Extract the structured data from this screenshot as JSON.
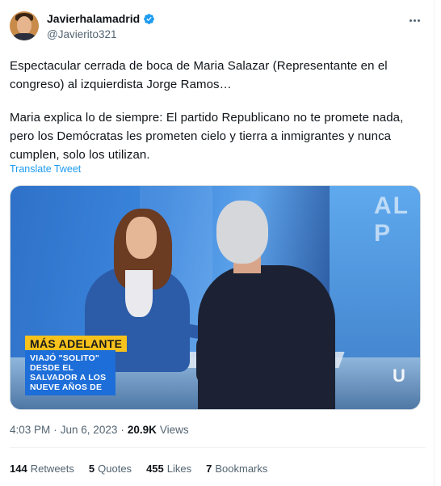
{
  "author": {
    "display_name": "Javierhalamadrid",
    "handle": "@Javierito321",
    "verified_badge_color": "#1d9bf0"
  },
  "tweet": {
    "paragraph_1": "Espectacular cerrada de boca de Maria Salazar (Representante en el congreso) al izquierdista Jorge Ramos…",
    "paragraph_2": "Maria explica lo de siempre: El partido Republicano no te promete nada, pero los Demócratas les prometen cielo y tierra a inmigrantes y nunca cumplen, solo los utilizan.",
    "translate_label": "Translate Tweet"
  },
  "media": {
    "background_text": "AL P",
    "network_logo_text": "U",
    "lower_third_title": "MÁS ADELANTE",
    "lower_third_lines": [
      "VIAJÓ \"SOLITO\"",
      "DESDE EL",
      "SALVADOR A LOS",
      "NUEVE AÑOS DE"
    ]
  },
  "meta": {
    "time": "4:03 PM",
    "separator": "·",
    "date": "Jun 6, 2023",
    "views_count": "20.9K",
    "views_label": "Views"
  },
  "stats": {
    "retweets_count": "144",
    "retweets_label": "Retweets",
    "quotes_count": "5",
    "quotes_label": "Quotes",
    "likes_count": "455",
    "likes_label": "Likes",
    "bookmarks_count": "7",
    "bookmarks_label": "Bookmarks"
  },
  "icons": {
    "more": "more-horizontal-icon",
    "verified": "verified-badge-icon"
  }
}
